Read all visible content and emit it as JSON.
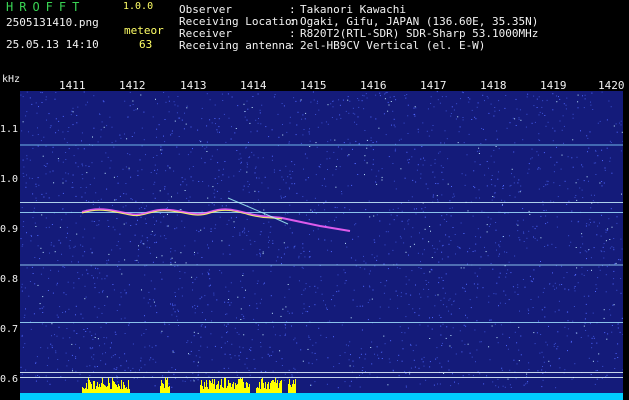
{
  "header": {
    "app_title": "HROFFT",
    "version": "1.0.0",
    "file_name": "2505131410.png",
    "datetime": "25.05.13 14:10",
    "meteor_label": "meteor",
    "meteor_count": "63"
  },
  "info": {
    "rows": [
      {
        "label": "Observer",
        "value": "Takanori Kawachi"
      },
      {
        "label": "Receiving Location",
        "value": "Ogaki, Gifu, JAPAN (136.60E, 35.35N)"
      },
      {
        "label": "Receiver",
        "value": "R820T2(RTL-SDR) SDR-Sharp 53.1000MHz"
      },
      {
        "label": "Receiving antenna",
        "value": "2el-HB9CV Vertical (el. E-W)"
      }
    ],
    "separator": ":"
  },
  "axes": {
    "y_unit": "kHz",
    "x_ticks": [
      "1411",
      "1412",
      "1413",
      "1414",
      "1415",
      "1416",
      "1417",
      "1418",
      "1419",
      "1420"
    ],
    "y_ticks": [
      "1.1",
      "1.0",
      "0.9",
      "0.8",
      "0.7",
      "0.6"
    ]
  },
  "spectrogram": {
    "background": "#141b7a",
    "noise_color": "#3a4fd0",
    "lines": [
      {
        "freq_khz": 1.07,
        "color": "#7fd3ff"
      },
      {
        "freq_khz": 0.955,
        "color": "#c8f0ff"
      },
      {
        "freq_khz": 0.935,
        "color": "#9fe0ff"
      },
      {
        "freq_khz": 0.83,
        "color": "#9fe0ff"
      },
      {
        "freq_khz": 0.715,
        "color": "#9fe0ff"
      },
      {
        "freq_khz": 0.615,
        "color": "#e6f8ff"
      },
      {
        "freq_khz": 0.605,
        "color": "#e6f8ff"
      }
    ],
    "activity_color": "#ffff00",
    "baseline_color": "#00ccff"
  }
}
